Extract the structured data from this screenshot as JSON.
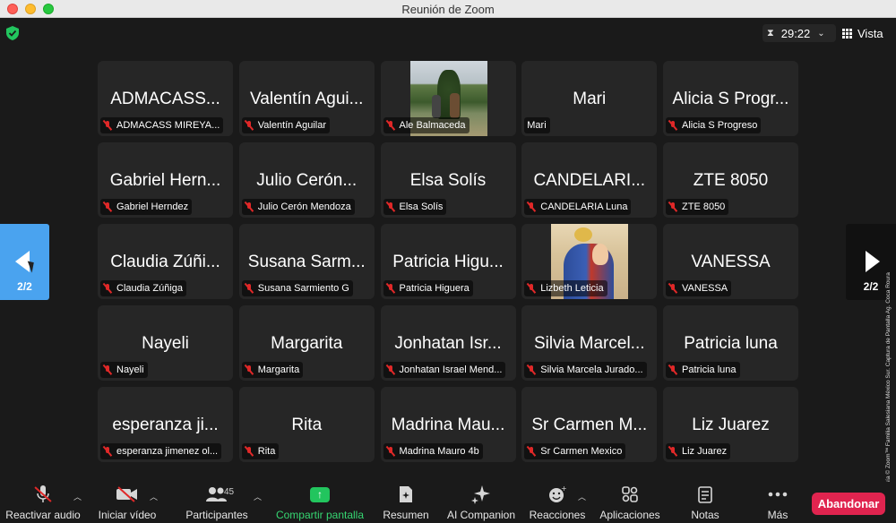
{
  "window": {
    "title": "Reunión de Zoom"
  },
  "topbar": {
    "timer": "29:22",
    "view_label": "Vista"
  },
  "participants": [
    {
      "display": "ADMACASS...",
      "label": "ADMACASS MIREYA..."
    },
    {
      "display": "Valentín Agui...",
      "label": "Valentín Aguilar"
    },
    {
      "display": "",
      "label": "Ale Balmaceda",
      "photo": "trees"
    },
    {
      "display": "Mari",
      "label": "Mari",
      "no_mic": true
    },
    {
      "display": "Alicia S Progr...",
      "label": "Alicia S Progreso"
    },
    {
      "display": "Gabriel Hern...",
      "label": "Gabriel Herndez"
    },
    {
      "display": "Julio Cerón...",
      "label": "Julio Cerón Mendoza"
    },
    {
      "display": "Elsa Solís",
      "label": "Elsa Solís"
    },
    {
      "display": "CANDELARI...",
      "label": "CANDELARIA Luna"
    },
    {
      "display": "ZTE 8050",
      "label": "ZTE 8050"
    },
    {
      "display": "Claudia Zúñi...",
      "label": "Claudia Zúñiga"
    },
    {
      "display": "Susana Sarm...",
      "label": "Susana Sarmiento G"
    },
    {
      "display": "Patricia Higu...",
      "label": "Patricia Higuera"
    },
    {
      "display": "",
      "label": "Lizbeth Leticia",
      "photo": "virgin-mary"
    },
    {
      "display": "VANESSA",
      "label": "VANESSA"
    },
    {
      "display": "Nayeli",
      "label": "Nayeli"
    },
    {
      "display": "Margarita",
      "label": "Margarita"
    },
    {
      "display": "Jonhatan Isr...",
      "label": "Jonhatan Israel Mend..."
    },
    {
      "display": "Silvia Marcel...",
      "label": "Silvia Marcela Jurado..."
    },
    {
      "display": "Patricia luna",
      "label": "Patricia luna"
    },
    {
      "display": "esperanza ji...",
      "label": "esperanza jimenez ol..."
    },
    {
      "display": "Rita",
      "label": "Rita"
    },
    {
      "display": "Madrina Mau...",
      "label": "Madrina Mauro 4b"
    },
    {
      "display": "Sr Carmen M...",
      "label": "Sr Carmen Mexico"
    },
    {
      "display": "Liz Juarez",
      "label": "Liz Juarez"
    }
  ],
  "pagination": {
    "left": "2/2",
    "right": "2/2"
  },
  "credit": "Cortesía © Zoom™ Familia Salesiana México Sur. Captura de Pantalla Ag. Coca Roura",
  "toolbar": {
    "audio": "Reactivar audio",
    "video": "Iniciar vídeo",
    "participants": "Participantes",
    "participants_count": "45",
    "share": "Compartir pantalla",
    "summary": "Resumen",
    "ai": "AI Companion",
    "reactions": "Reacciones",
    "apps": "Aplicaciones",
    "notes": "Notas",
    "more": "Más",
    "leave": "Abandonar"
  },
  "colors": {
    "accent_blue": "#4aa3ef",
    "share_green": "#22c55e",
    "leave_red": "#e0244f",
    "muted_red": "#e02828",
    "tile_bg": "#262626"
  },
  "icons": {
    "security": "shield-check-icon",
    "timer": "hourglass-icon",
    "view": "grid-icon",
    "audio": "microphone-muted-icon",
    "video": "camera-off-icon",
    "participants": "people-icon",
    "share": "share-screen-icon",
    "summary": "summary-icon",
    "ai": "sparkle-icon",
    "reactions": "emoji-icon",
    "apps": "apps-icon",
    "notes": "notes-icon",
    "more": "more-icon"
  }
}
